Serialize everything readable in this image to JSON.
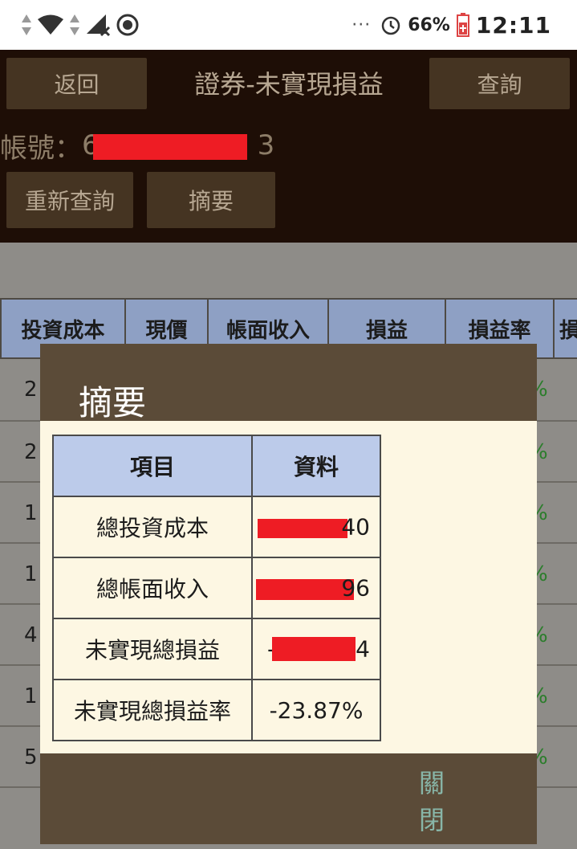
{
  "status_bar": {
    "dots": "···",
    "battery_pct": "66%",
    "clock": "12:11"
  },
  "header": {
    "back_label": "返回",
    "title": "證券-未實現損益",
    "query_label": "查詢",
    "account_label": "帳號：",
    "account_prefix": "6",
    "account_suffix": "3",
    "requery_label": "重新查詢",
    "summary_label": "摘要"
  },
  "background_table": {
    "columns": [
      "投資成本",
      "現價",
      "帳面收入",
      "損益",
      "損益率",
      "損"
    ],
    "row_leads": [
      "2",
      "2",
      "1",
      "1",
      "4",
      "1",
      "5"
    ],
    "row_tails": [
      "%",
      "%",
      "%",
      "%",
      "%",
      "%",
      "%"
    ]
  },
  "dialog": {
    "title": "摘要",
    "col_item": "項目",
    "col_data": "資料",
    "rows": [
      {
        "label": "總投資成本",
        "value_tail": "40"
      },
      {
        "label": "總帳面收入",
        "value_tail": "96"
      },
      {
        "label": "未實現總損益",
        "value_tail": "4",
        "value_head": "-"
      },
      {
        "label": "未實現總損益率",
        "value": "-23.87%"
      }
    ],
    "close_label": "關閉"
  },
  "colors": {
    "header_bg": "#1e0e06",
    "button_bg": "#453422",
    "dialog_bg": "#5b4b38",
    "table_head_bg": "#bccbea",
    "gain_loss_green": "#2b8f2b",
    "redaction_red": "#ee1c24",
    "close_text": "#88b6a8"
  }
}
